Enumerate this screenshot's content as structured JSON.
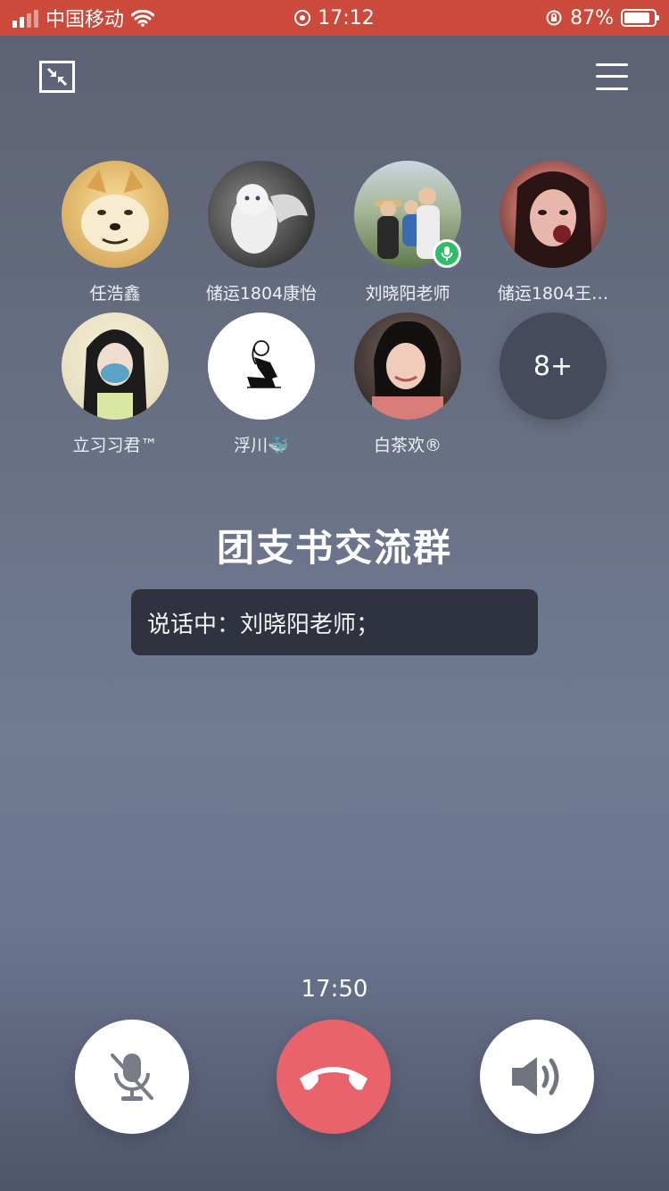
{
  "status_bar": {
    "carrier": "中国移动",
    "time": "17:12",
    "battery_percent": "87%",
    "battery_level": 0.87,
    "signal_bars": 2
  },
  "participants": [
    {
      "name": "任浩鑫",
      "avatar_colors": [
        "#f3dc9c",
        "#d4a254"
      ],
      "speaking": false
    },
    {
      "name": "储运1804康怡",
      "avatar_colors": [
        "#e8e8e8",
        "#5a5a5a"
      ],
      "speaking": false
    },
    {
      "name": "刘晓阳老师",
      "avatar_colors": [
        "#9fbb7f",
        "#4c5e3a"
      ],
      "speaking": true
    },
    {
      "name": "储运1804王…",
      "avatar_colors": [
        "#d99890",
        "#5a2e2e"
      ],
      "speaking": false
    },
    {
      "name": "立习习君™",
      "avatar_colors": [
        "#eee7d0",
        "#2a2a2a"
      ],
      "speaking": false
    },
    {
      "name": "浮川🐳",
      "avatar_colors": [
        "#ffffff",
        "#111111"
      ],
      "speaking": false
    },
    {
      "name": "白茶欢®",
      "avatar_colors": [
        "#d7a69a",
        "#3a2a28"
      ],
      "speaking": false
    }
  ],
  "more_count": "8+",
  "group_name": "团支书交流群",
  "speaking_text": "说话中：刘晓阳老师；",
  "call_duration": "17:50",
  "colors": {
    "status_bar": "#cc4a3b",
    "hangup": "#e8636b",
    "mic_badge": "#2fbd6a",
    "speaking_box": "#2f3340"
  },
  "icons": {
    "minimize": "minimize-icon",
    "menu": "menu-icon",
    "mute": "mic-off-icon",
    "hangup": "phone-hangup-icon",
    "speaker": "speaker-icon"
  }
}
